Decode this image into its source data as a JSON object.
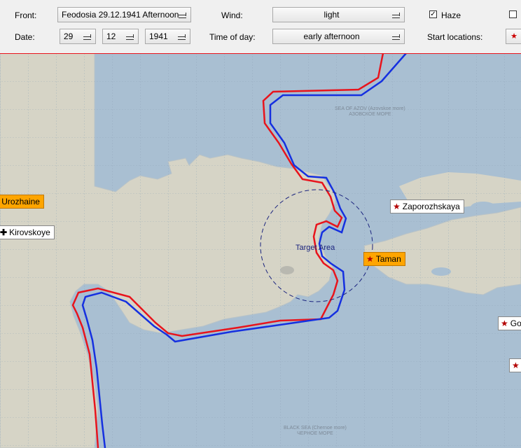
{
  "toolbar": {
    "front_label": "Front:",
    "front_value": "Feodosia 29.12.1941 Afternoon",
    "wind_label": "Wind:",
    "wind_value": "light",
    "haze_label": "Haze",
    "haze_checked": true,
    "date_label": "Date:",
    "date_day": "29",
    "date_month": "12",
    "date_year": "1941",
    "time_label": "Time of day:",
    "time_value": "early afternoon",
    "start_label": "Start locations:",
    "start_icon": "star-icon"
  },
  "map": {
    "sea_top_en": "SEA OF AZOV (Azovskoe more)",
    "sea_top_ru": "АЗОВСКОЕ МОРЕ",
    "sea_bottom_en": "BLACK SEA (Chernoe more)",
    "sea_bottom_ru": "ЧЕРНОЕ МОРЕ",
    "target_label": "Target Area",
    "locations": [
      {
        "name": "Urozhaine",
        "icon": "airfield-icon",
        "highlight": true
      },
      {
        "name": "Kirovskoye",
        "icon": "plus-icon",
        "highlight": false
      },
      {
        "name": "Zaporozhskaya",
        "icon": "star-icon",
        "highlight": false
      },
      {
        "name": "Taman",
        "icon": "star-icon",
        "highlight": true
      },
      {
        "name": "Go",
        "icon": "star-icon",
        "highlight": false
      },
      {
        "name": "",
        "icon": "star-icon",
        "highlight": false
      }
    ],
    "colors": {
      "sea": "#a9bfd2",
      "land": "#d6d4c6",
      "red_front": "#e8141c",
      "blue_front": "#1530e0",
      "target_circle": "#1a237e",
      "highlight": "#ffa500"
    }
  }
}
